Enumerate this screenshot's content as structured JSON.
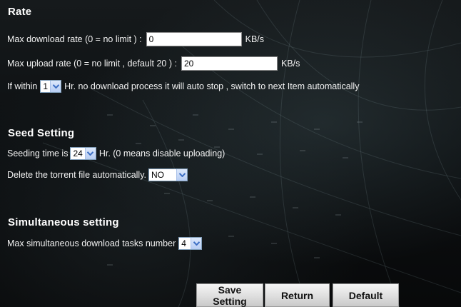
{
  "rate": {
    "title": "Rate",
    "max_download": {
      "label": "Max download rate (0 = no limit )  :",
      "value": "0",
      "unit": "KB/s"
    },
    "max_upload": {
      "label": "Max upload rate (0 = no limit , default 20 )  :",
      "value": "20",
      "unit": "KB/s"
    },
    "auto_stop": {
      "prefix": "If within",
      "selected": "1",
      "suffix": "Hr. no download process it will auto stop , switch to next Item automatically"
    }
  },
  "seed": {
    "title": "Seed Setting",
    "seeding_time": {
      "prefix": "Seeding time is",
      "selected": "24",
      "suffix": "Hr. (0 means disable uploading)"
    },
    "delete_torrent": {
      "label": "Delete the torrent file automatically.",
      "selected": "NO"
    }
  },
  "simultaneous": {
    "title": "Simultaneous setting",
    "max_tasks": {
      "label": "Max simultaneous download tasks number",
      "selected": "4"
    }
  },
  "buttons": {
    "save": "Save Setting",
    "return": "Return",
    "default": "Default"
  },
  "icons": {
    "dropdown": "chevron-down-icon"
  },
  "colors": {
    "background": "#0c0f11",
    "text": "#ffffff",
    "dropdown_arrow": "#3d6fc4"
  }
}
